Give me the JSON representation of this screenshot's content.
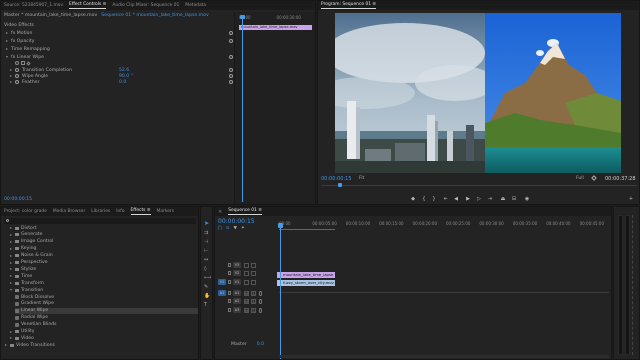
{
  "effect_controls": {
    "tabs": [
      {
        "label": "Source: 523845907_1.mov"
      },
      {
        "label": "Effect Controls ≡"
      },
      {
        "label": "Audio Clip Mixer: Sequence 01"
      },
      {
        "label": "Metadata"
      }
    ],
    "source_label": "Master * mountain_lake_time_lapse.mov",
    "sequence_label": "Sequence 01 * mountain_lake_time_lapse.mov",
    "section_title": "Video Effects",
    "properties": [
      {
        "name": "fx  Motion"
      },
      {
        "name": "fx  Opacity"
      },
      {
        "name": "Time Remapping"
      },
      {
        "name": "fx  Linear Wipe"
      }
    ],
    "wipe_props": [
      {
        "name": "Transition Completion",
        "value": "52.6"
      },
      {
        "name": "Wipe Angle",
        "value": "90.0 °"
      },
      {
        "name": "Feather",
        "value": "0.0"
      }
    ],
    "mini_timeline": {
      "start": "00:00",
      "end": "00:00:30:00",
      "clip": "mountain_lake_time_lapse.mov"
    },
    "timecode": "00:00:00:15"
  },
  "program_monitor": {
    "title": "Program: Sequence 01 ≡",
    "timecode": "00:00:00:15",
    "fit": "Fit",
    "quality": "Full",
    "duration": "00:00:37:28"
  },
  "project_panel": {
    "tabs": [
      {
        "label": "Project: color grade"
      },
      {
        "label": "Media Browser"
      },
      {
        "label": "Libraries"
      },
      {
        "label": "Info"
      },
      {
        "label": "Effects ≡"
      },
      {
        "label": "Markers"
      }
    ],
    "items": [
      {
        "label": "Distort",
        "indent": 1,
        "type": "folder"
      },
      {
        "label": "Generate",
        "indent": 1,
        "type": "folder"
      },
      {
        "label": "Image Control",
        "indent": 1,
        "type": "folder"
      },
      {
        "label": "Keying",
        "indent": 1,
        "type": "folder"
      },
      {
        "label": "Noise & Grain",
        "indent": 1,
        "type": "folder"
      },
      {
        "label": "Perspective",
        "indent": 1,
        "type": "folder"
      },
      {
        "label": "Stylize",
        "indent": 1,
        "type": "folder"
      },
      {
        "label": "Time",
        "indent": 1,
        "type": "folder"
      },
      {
        "label": "Transform",
        "indent": 1,
        "type": "folder"
      },
      {
        "label": "Transition",
        "indent": 1,
        "type": "folder-open"
      },
      {
        "label": "Block Dissolve",
        "indent": 2,
        "type": "fx"
      },
      {
        "label": "Gradient Wipe",
        "indent": 2,
        "type": "fx"
      },
      {
        "label": "Linear Wipe",
        "indent": 2,
        "type": "fx",
        "selected": true
      },
      {
        "label": "Radial Wipe",
        "indent": 2,
        "type": "fx"
      },
      {
        "label": "Venetian Blinds",
        "indent": 2,
        "type": "fx"
      },
      {
        "label": "Utility",
        "indent": 1,
        "type": "folder"
      },
      {
        "label": "Video",
        "indent": 1,
        "type": "folder"
      },
      {
        "label": "Video Transitions",
        "indent": 0,
        "type": "folder"
      }
    ]
  },
  "timeline": {
    "tab": "Sequence 01 ≡",
    "timecode": "00:00:00:15",
    "ruler": [
      "00:00",
      "00:00:05:00",
      "00:00:10:00",
      "00:00:15:00",
      "00:00:20:00",
      "00:00:25:00",
      "00:00:30:00",
      "00:00:35:00",
      "00:00:40:00",
      "00:00:45:00"
    ],
    "tracks": [
      {
        "label": "V3"
      },
      {
        "label": "V2"
      },
      {
        "label": "V1"
      },
      {
        "label": "A1"
      },
      {
        "label": "A2"
      },
      {
        "label": "A3"
      }
    ],
    "clips": [
      {
        "label": "mountain_lake_time_lapse"
      },
      {
        "label": "fuzzy_storm_over_city.mov"
      }
    ],
    "master_label": "Master",
    "master_value": "0.0"
  },
  "colors": {
    "accent_blue": "#3d95e8",
    "playhead_blue": "#4a9be6",
    "clip_video": "#a8c3e4",
    "clip_pink": "#c9a3ea",
    "panel_bg": "#232323"
  }
}
